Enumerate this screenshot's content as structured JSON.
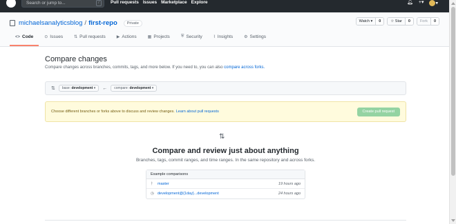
{
  "topbar": {
    "search_placeholder": "Search or jump to...",
    "slash_hint": "/",
    "nav": [
      "Pull requests",
      "Issues",
      "Marketplace",
      "Explore"
    ],
    "right_icons": [
      "bell-icon",
      "plus-icon",
      "avatar-icon"
    ]
  },
  "repo": {
    "owner": "michaelsanalyticsblog",
    "separator": "/",
    "name": "first-repo",
    "visibility": "Private",
    "watch_label": "Watch ▾",
    "watch_count": "0",
    "star_label": "☆ Star",
    "star_count": "0",
    "fork_label": "Fork",
    "fork_count": "0"
  },
  "tabs": [
    {
      "label": "Code",
      "icon": "<>"
    },
    {
      "label": "Issues",
      "icon": "⊙"
    },
    {
      "label": "Pull requests",
      "icon": "⇅"
    },
    {
      "label": "Actions",
      "icon": "▶"
    },
    {
      "label": "Projects",
      "icon": "▦"
    },
    {
      "label": "Security",
      "icon": "⛨"
    },
    {
      "label": "Insights",
      "icon": "⌇"
    },
    {
      "label": "Settings",
      "icon": "⚙"
    }
  ],
  "compare": {
    "title": "Compare changes",
    "subtitle": "Compare changes across branches, commits, tags, and more below. If you need to, you can also",
    "subtitle_link": "compare across forks.",
    "base_prefix": "base:",
    "base_value": "development",
    "compare_prefix": "compare:",
    "compare_value": "development",
    "arrow": "←",
    "flash_text": "Choose different branches or forks above to discuss and review changes.",
    "flash_link": "Learn about pull requests",
    "create_pr": "Create pull request"
  },
  "blankslate": {
    "title": "Compare and review just about anything",
    "text": "Branches, tags, commit ranges, and time ranges. In the same repository and across forks."
  },
  "examples": {
    "header": "Example comparisons",
    "rows": [
      {
        "label": "master",
        "time": "19 hours ago"
      },
      {
        "label": "development@{1day}...development",
        "time": "24 hours ago"
      }
    ]
  }
}
